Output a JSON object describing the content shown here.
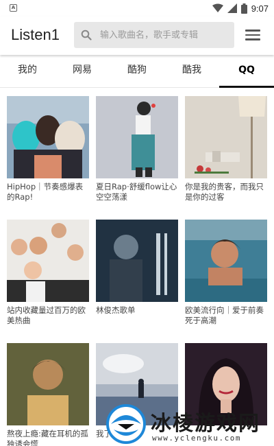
{
  "status_bar": {
    "time": "9:07",
    "notification_icon": "A",
    "icons": [
      "notification-icon",
      "wifi-icon",
      "signal-icon",
      "battery-icon"
    ]
  },
  "app_bar": {
    "title": "Listen1",
    "search_placeholder": "输入歌曲名，歌手或专辑",
    "search_value": "",
    "search_icon": "search-icon",
    "menu_icon": "hamburger-menu-icon"
  },
  "tabs": [
    {
      "label": "我的",
      "active": false
    },
    {
      "label": "网易",
      "active": false
    },
    {
      "label": "酷狗",
      "active": false
    },
    {
      "label": "酷我",
      "active": false
    },
    {
      "label": "QQ",
      "active": true
    }
  ],
  "playlists": [
    {
      "title": "HipHop｜节奏感爆表的Rap!"
    },
    {
      "title": "夏日Rap·舒缓flow让心空空荡漾"
    },
    {
      "title": "你是我的贵客，而我只是你的过客"
    },
    {
      "title": "站内收藏量过百万的欧美热曲"
    },
    {
      "title": "林俊杰歌单"
    },
    {
      "title": "欧美流行向｜爱于前奏死于高潮"
    },
    {
      "title": "熬夜上瘾:藏在耳机的孤独诱会慌"
    },
    {
      "title": "我了"
    },
    {
      "title": ""
    }
  ],
  "watermark": {
    "title": "冰棱游戏网",
    "url": "www.yclengku.com"
  },
  "colors": {
    "tab_indicator": "#111111",
    "search_bg": "#e7e7e7",
    "watermark_blue": "#1e88d8"
  }
}
